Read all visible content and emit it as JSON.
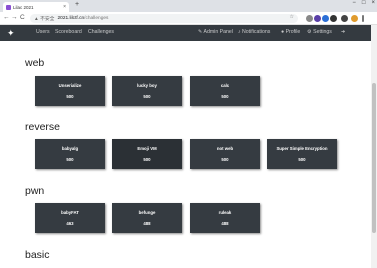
{
  "browser": {
    "tab_title": "Lilac 2021",
    "tab_close": "×",
    "new_tab": "+",
    "min": "−",
    "max": "□",
    "close": "×",
    "back": "←",
    "forward": "→",
    "reload": "C",
    "warning": "▲ 不安全",
    "host": "2021.lilctf.cn",
    "path": "/challenges",
    "star": "☆"
  },
  "navbar": {
    "brand": "✦",
    "users": "Users",
    "scoreboard": "Scoreboard",
    "challenges": "Challenges",
    "admin_panel": "Admin Panel",
    "notifications": "Notifications",
    "profile": "Profile",
    "settings": "Settings",
    "logout": "➜"
  },
  "categories": [
    {
      "name": "web",
      "challenges": [
        {
          "name": "Unserialize",
          "points": "500"
        },
        {
          "name": "lucky boy",
          "points": "500"
        },
        {
          "name": "calc",
          "points": "500"
        }
      ]
    },
    {
      "name": "reverse",
      "challenges": [
        {
          "name": "babyalg",
          "points": "500"
        },
        {
          "name": "Emoji VM",
          "points": "500"
        },
        {
          "name": "not web",
          "points": "500"
        },
        {
          "name": "Super Simple Encryption",
          "points": "500"
        }
      ]
    },
    {
      "name": "pwn",
      "challenges": [
        {
          "name": "babyFAT",
          "points": "463"
        },
        {
          "name": "befunge",
          "points": "488"
        },
        {
          "name": "ruleak",
          "points": "488"
        }
      ]
    },
    {
      "name": "basic",
      "challenges": []
    }
  ],
  "colors": {
    "navbar": "#343a40",
    "card": "#353b41",
    "tab_favicon": "#8a4fd3"
  }
}
